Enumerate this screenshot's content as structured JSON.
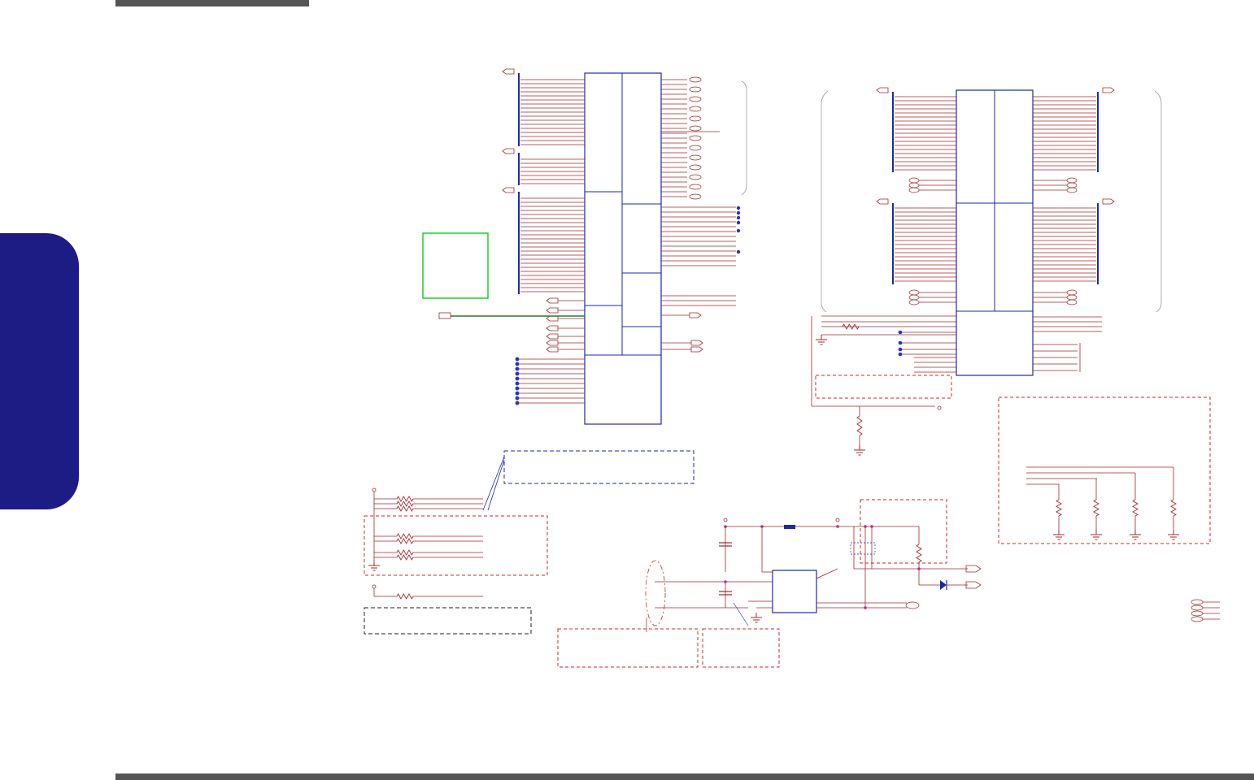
{
  "page": {
    "header_bar": "",
    "footer_bar": "",
    "side_tab": ""
  },
  "colors": {
    "net": "#a0282c",
    "ic": "#1a2aa8",
    "junction": "#2233cc",
    "note_box": "#cc2a2a",
    "green_box": "#22cc22",
    "green_wire": "#2a7a2a",
    "tab": "#1c1c84",
    "bar": "#555555"
  },
  "schematic": {
    "text_labels": []
  }
}
